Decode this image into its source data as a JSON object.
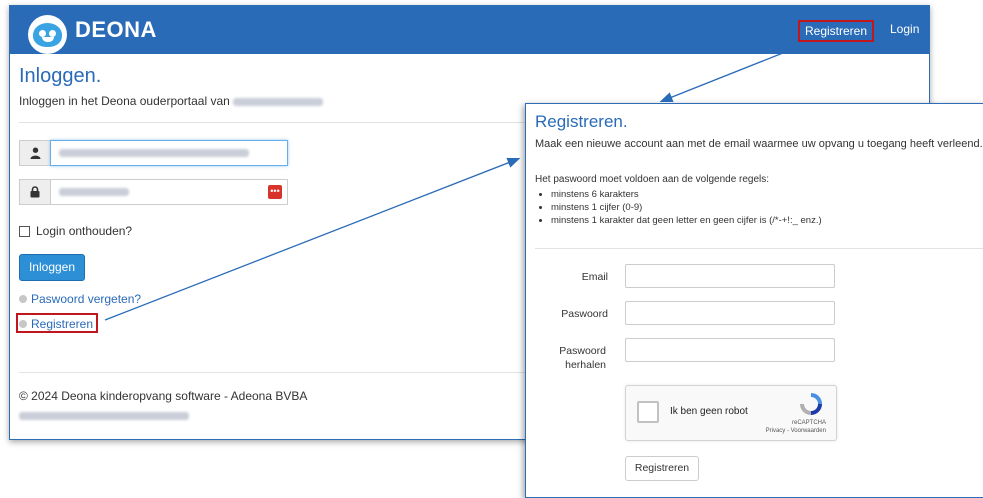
{
  "app": {
    "brand": "DEONA"
  },
  "nav": {
    "register": "Registreren",
    "login": "Login"
  },
  "login": {
    "title": "Inloggen.",
    "subtitle": "Inloggen in het Deona ouderportaal van",
    "remember_label": "Login onthouden?",
    "submit": "Inloggen",
    "forgot_link": "Paswoord vergeten?",
    "register_link": "Registreren",
    "footer": "© 2024 Deona kinderopvang software - Adeona BVBA"
  },
  "register": {
    "title": "Registreren.",
    "intro": "Maak een nieuwe account aan met de email waarmee uw opvang u toegang heeft verleend.",
    "rules_heading": "Het paswoord moet voldoen aan de volgende regels:",
    "rules": [
      "minstens 6 karakters",
      "minstens 1 cijfer (0-9)",
      "minstens 1 karakter dat geen letter en geen cijfer is (/*-+!:_ enz.)"
    ],
    "email_label": "Email",
    "password_label": "Paswoord",
    "password_repeat_label": "Paswoord herhalen",
    "captcha_label": "Ik ben geen robot",
    "captcha_brand": "reCAPTCHA",
    "captcha_links": "Privacy - Voorwaarden",
    "submit": "Registreren"
  },
  "colors": {
    "brand": "#2a6bb8",
    "highlight": "#c1161c",
    "button": "#2d8fd6"
  },
  "icons": {
    "user": "user-icon",
    "lock": "lock-icon",
    "password_manager": "password-manager-icon",
    "captcha": "recaptcha-icon"
  }
}
